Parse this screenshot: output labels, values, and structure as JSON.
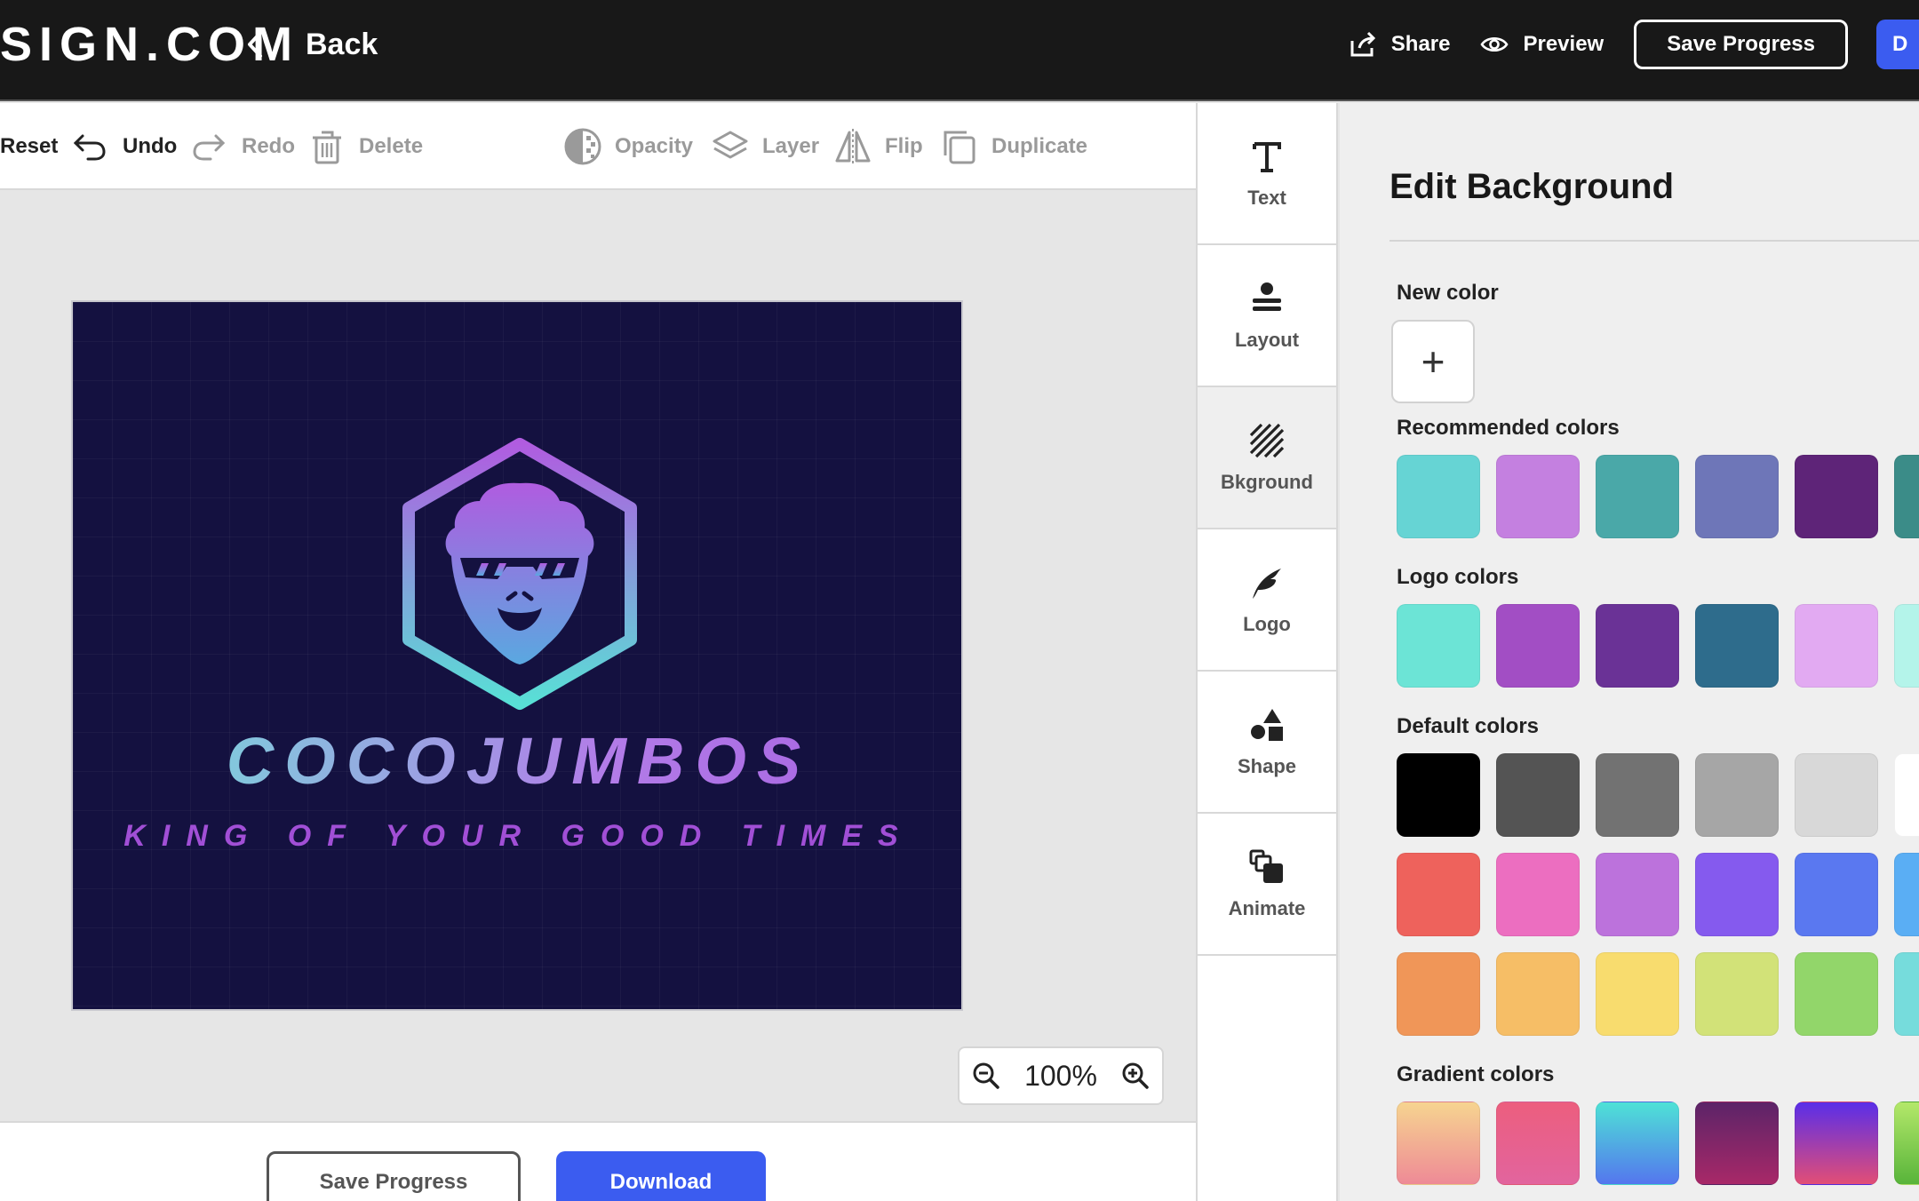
{
  "topbar": {
    "brand": "SIGN.COM",
    "back_label": "Back",
    "share_label": "Share",
    "preview_label": "Preview",
    "save_label": "Save Progress",
    "download_label": "D"
  },
  "toolbar": {
    "reset": "Reset",
    "undo": "Undo",
    "redo": "Redo",
    "delete": "Delete",
    "opacity": "Opacity",
    "layer": "Layer",
    "flip": "Flip",
    "duplicate": "Duplicate"
  },
  "canvas": {
    "company_name": "COCOJUMBOS",
    "tagline": "KING OF YOUR GOOD TIMES",
    "background_color": "#141140"
  },
  "zoom": {
    "value": "100%"
  },
  "bottom": {
    "save_label": "Save Progress",
    "download_label": "Download"
  },
  "side_tabs": [
    {
      "label": "Text",
      "icon": "text-icon"
    },
    {
      "label": "Layout",
      "icon": "layout-icon"
    },
    {
      "label": "Bkground",
      "icon": "background-icon",
      "active": true
    },
    {
      "label": "Logo",
      "icon": "logo-icon"
    },
    {
      "label": "Shape",
      "icon": "shape-icon"
    },
    {
      "label": "Animate",
      "icon": "animate-icon"
    }
  ],
  "panel": {
    "title": "Edit Background",
    "new_color_label": "New color",
    "new_color_symbol": "+",
    "recommended_label": "Recommended colors",
    "recommended": [
      "#66d4d4",
      "#c480e0",
      "#4aa8a8",
      "#6e76b8",
      "#5e2478",
      "#3b8c88"
    ],
    "logo_label": "Logo colors",
    "logo": [
      "#6ce4d6",
      "#a24ec4",
      "#6a3296",
      "#2e6c8c",
      "#e2aaf2",
      "#b4f4ea"
    ],
    "default_label": "Default colors",
    "default_rows": [
      [
        "#000000",
        "#545454",
        "#727272",
        "#a6a6a6",
        "#d8d8d8",
        "#ffffff"
      ],
      [
        "#ee625c",
        "#ec6ec0",
        "#bc72dc",
        "#855aee",
        "#5a78f0",
        "#5aaef4"
      ],
      [
        "#f09658",
        "#f6be66",
        "#f8dc6e",
        "#d2e278",
        "#92d66a",
        "#76dcdc"
      ]
    ],
    "gradient_label": "Gradient colors",
    "gradients": [
      [
        "#f6d490",
        "#ee8a96"
      ],
      [
        "#ec5e7e",
        "#e2649e"
      ],
      [
        "#4ee2d6",
        "#5476ee"
      ],
      [
        "#5c2468",
        "#a82868"
      ],
      [
        "#5a2ee8",
        "#e24e76"
      ],
      [
        "#b4e86a",
        "#58b43a"
      ]
    ]
  }
}
